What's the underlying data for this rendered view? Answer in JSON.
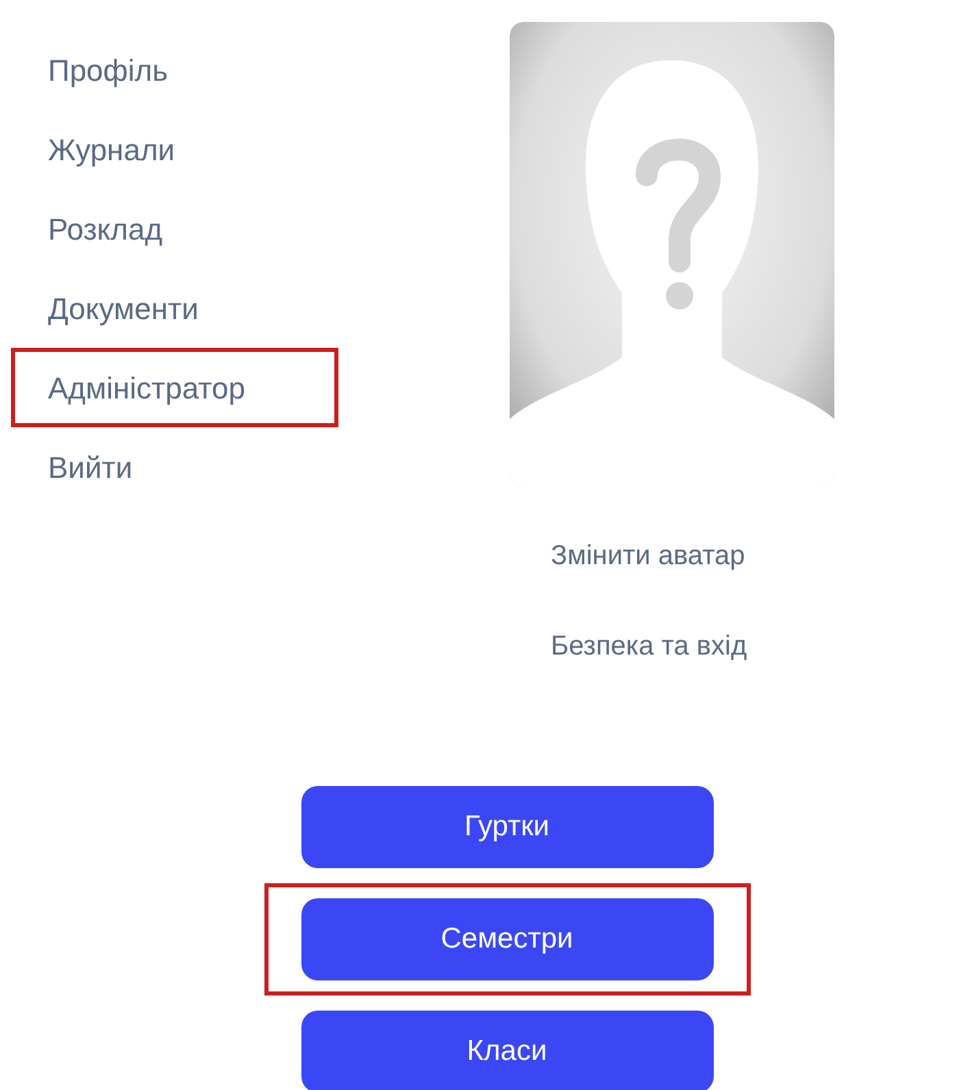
{
  "menu": [
    {
      "label": "Профіль",
      "highlighted": false
    },
    {
      "label": "Журнали",
      "highlighted": false
    },
    {
      "label": "Розклад",
      "highlighted": false
    },
    {
      "label": "Документи",
      "highlighted": false
    },
    {
      "label": "Адміністратор",
      "highlighted": true
    },
    {
      "label": "Вийти",
      "highlighted": false
    }
  ],
  "profile_links": [
    "Змінити аватар",
    "Безпека та вхід"
  ],
  "buttons": [
    {
      "label": "Гуртки",
      "highlighted": false
    },
    {
      "label": "Семестри",
      "highlighted": true
    },
    {
      "label": "Класи",
      "highlighted": false
    }
  ]
}
